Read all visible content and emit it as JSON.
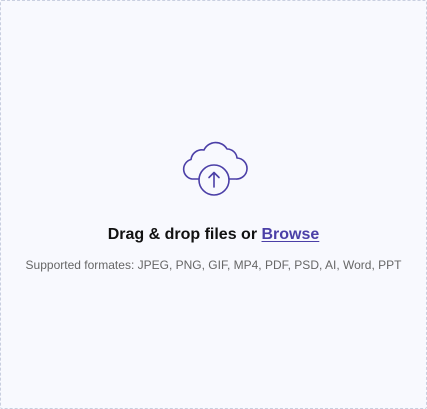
{
  "upload": {
    "icon": "cloud-upload-icon",
    "prompt_text": "Drag & drop files or",
    "browse_label": "Browse",
    "supported_formats": "Supported formates: JPEG, PNG, GIF, MP4, PDF, PSD, AI, Word, PPT"
  },
  "colors": {
    "accent": "#4b3fa7",
    "background": "#f8f9fe",
    "border": "#c9cfe0",
    "title_text": "#111111",
    "muted_text": "#666666"
  }
}
